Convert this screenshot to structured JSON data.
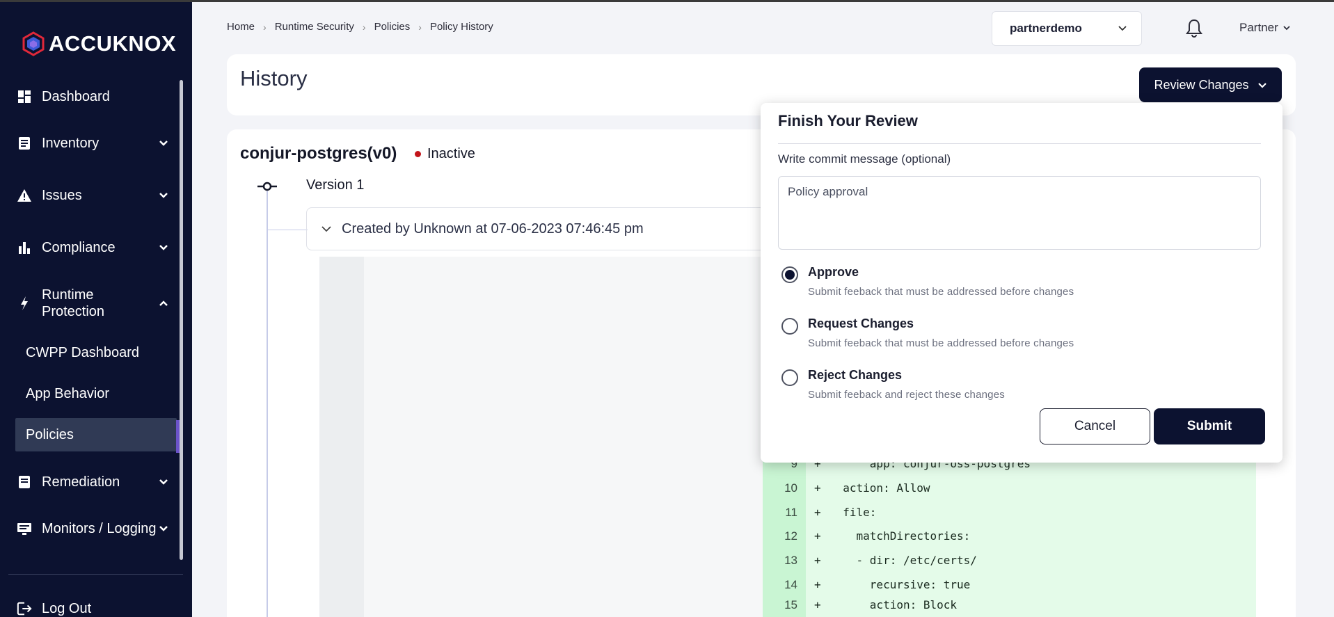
{
  "brand": {
    "name": "ACCUKNOX",
    "accent": "#0c1230",
    "highlight": "#6b53c9"
  },
  "sidebar": {
    "items": [
      {
        "label": "Dashboard",
        "icon": "dashboard-icon"
      },
      {
        "label": "Inventory",
        "icon": "inventory-icon"
      },
      {
        "label": "Issues",
        "icon": "warning-icon"
      },
      {
        "label": "Compliance",
        "icon": "bar-chart-icon"
      },
      {
        "label": "Runtime Protection",
        "icon": "lightning-icon"
      },
      {
        "label": "Remediation",
        "icon": "remediation-icon"
      },
      {
        "label": "Monitors / Logging",
        "icon": "monitor-icon"
      }
    ],
    "sub_items": [
      {
        "label": "CWPP Dashboard"
      },
      {
        "label": "App Behavior"
      },
      {
        "label": "Policies",
        "active": true
      }
    ],
    "logout": "Log Out"
  },
  "breadcrumb": [
    "Home",
    "Runtime Security",
    "Policies",
    "Policy History"
  ],
  "header": {
    "tenant": "partnerdemo",
    "user": "Partner"
  },
  "page": {
    "title": "History",
    "review_button": "Review Changes",
    "policy_name": "conjur-postgres(v0)",
    "status": "Inactive",
    "status_color": "#c3141a",
    "version": "Version 1",
    "created": "Created by Unknown at 07-06-2023 07:46:45 pm"
  },
  "diff": {
    "lines": [
      {
        "num": "9",
        "sign": "+",
        "code": "      app: conjur-oss-postgres"
      },
      {
        "num": "10",
        "sign": "+",
        "code": "  action: Allow"
      },
      {
        "num": "11",
        "sign": "+",
        "code": "  file:"
      },
      {
        "num": "12",
        "sign": "+",
        "code": "    matchDirectories:"
      },
      {
        "num": "13",
        "sign": "+",
        "code": "    - dir: /etc/certs/"
      },
      {
        "num": "14",
        "sign": "+",
        "code": "      recursive: true"
      },
      {
        "num": "15",
        "sign": "+",
        "code": "      action: Block"
      }
    ]
  },
  "review_popup": {
    "title": "Finish Your Review",
    "commit_label": "Write commit message (optional)",
    "commit_value": "Policy approval",
    "options": [
      {
        "title": "Approve",
        "desc": "Submit feeback that must be addressed before changes",
        "selected": true
      },
      {
        "title": "Request Changes",
        "desc": "Submit feeback that must be addressed before changes",
        "selected": false
      },
      {
        "title": "Reject Changes",
        "desc": "Submit feeback and reject these changes",
        "selected": false
      }
    ],
    "cancel": "Cancel",
    "submit": "Submit"
  }
}
